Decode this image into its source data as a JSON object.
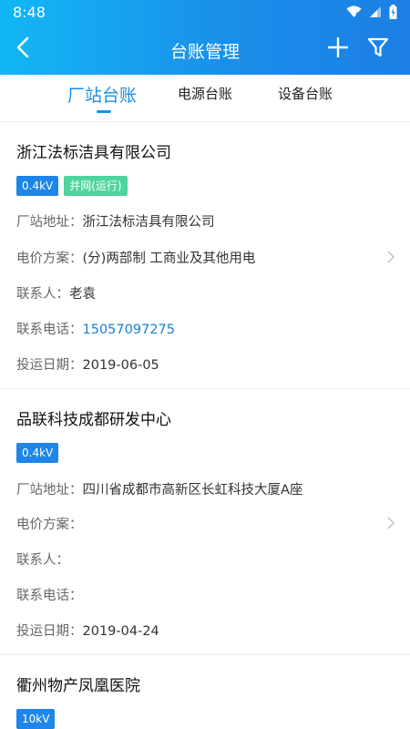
{
  "status_bar": {
    "time": "8:48"
  },
  "navbar": {
    "title": "台账管理"
  },
  "tabs": [
    {
      "label": "厂站台账",
      "active": true
    },
    {
      "label": "电源台账",
      "active": false
    },
    {
      "label": "设备台账",
      "active": false
    }
  ],
  "colors": {
    "header_start": "#12b7f5",
    "header_end": "#1c7fe4",
    "accent": "#1a8fe9",
    "voltage_badge": "#1d86e8",
    "status_badge": "#4fd49c",
    "phone_link": "#1a7fd4"
  },
  "labels": {
    "address": "厂站地址：",
    "tariff": "电价方案：",
    "contact": "联系人：",
    "phone": "联系电话：",
    "commission_date": "投运日期："
  },
  "stations": [
    {
      "name": "浙江法标洁具有限公司",
      "voltage": "0.4kV",
      "status": "并网(运行)",
      "address": "浙江法标洁具有限公司",
      "tariff": "(分)两部制 工商业及其他用电",
      "contact": "老袁",
      "phone": "15057097275",
      "commission_date": "2019-06-05"
    },
    {
      "name": "品联科技成都研发中心",
      "voltage": "0.4kV",
      "address": "四川省成都市高新区长虹科技大厦A座",
      "tariff": "",
      "contact": "",
      "phone": "",
      "commission_date": "2019-04-24"
    },
    {
      "name": "衢州物产凤凰医院",
      "voltage": "10kV"
    }
  ]
}
